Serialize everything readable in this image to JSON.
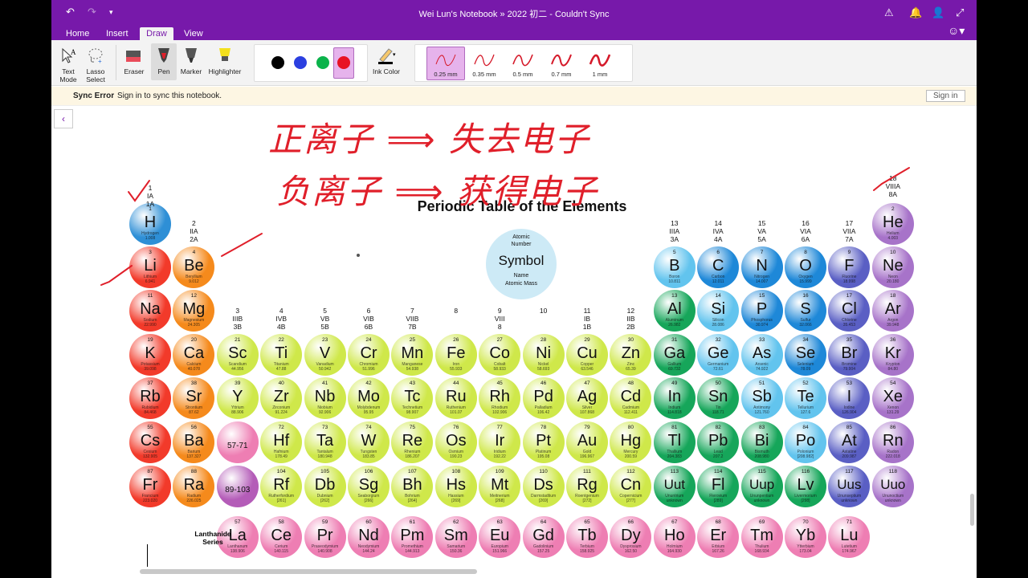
{
  "app": {
    "title": "Wei Lun's Notebook  »  2022 初二 - Couldn't Sync"
  },
  "tabs": [
    "Home",
    "Insert",
    "Draw",
    "View"
  ],
  "active_tab": "Draw",
  "ribbon": {
    "tools": [
      {
        "label": "Text Mode"
      },
      {
        "label": "Lasso Select"
      },
      {
        "label": "Eraser"
      },
      {
        "label": "Pen"
      },
      {
        "label": "Marker"
      },
      {
        "label": "Highlighter"
      }
    ],
    "colors": [
      "#000000",
      "#2b3fe0",
      "#0bb34b",
      "#e81224"
    ],
    "ink_color_label": "Ink Color",
    "pen_sizes": [
      "0.25 mm",
      "0.35 mm",
      "0.5 mm",
      "0.7 mm",
      "1 mm"
    ]
  },
  "sync": {
    "title": "Sync Error",
    "message": "Sign in to sync this notebook.",
    "button": "Sign in"
  },
  "handwriting": {
    "line1": "正离子 ⟹ 失去电子",
    "line2": "负离子 ⟹ 获得电子"
  },
  "table": {
    "title": "Periodic Table of the Elements",
    "legend": {
      "number": "Atomic Number",
      "symbol": "Symbol",
      "name": "Name",
      "mass": "Atomic  Mass"
    },
    "groups": [
      [
        "1",
        "IA",
        "1A"
      ],
      [
        "2",
        "IIA",
        "2A"
      ],
      [
        "3",
        "IIIB",
        "3B"
      ],
      [
        "4",
        "IVB",
        "4B"
      ],
      [
        "5",
        "VB",
        "5B"
      ],
      [
        "6",
        "VIB",
        "6B"
      ],
      [
        "7",
        "VIIB",
        "7B"
      ],
      [
        "8",
        "",
        ""
      ],
      [
        "9",
        "VIII",
        "8"
      ],
      [
        "10",
        "",
        ""
      ],
      [
        "11",
        "IB",
        "1B"
      ],
      [
        "12",
        "IIB",
        "2B"
      ],
      [
        "13",
        "IIIA",
        "3A"
      ],
      [
        "14",
        "IVA",
        "4A"
      ],
      [
        "15",
        "VA",
        "5A"
      ],
      [
        "16",
        "VIA",
        "6A"
      ],
      [
        "17",
        "VIIA",
        "7A"
      ],
      [
        "18",
        "VIIIA",
        "8A"
      ]
    ],
    "lanthanide_label": "Lanthanide Series",
    "elements": [
      [
        "1",
        "H",
        "Hydrogen",
        "1.008",
        1,
        1,
        "s1"
      ],
      [
        "2",
        "He",
        "Helium",
        "4.003",
        18,
        1,
        "ng"
      ],
      [
        "3",
        "Li",
        "Lithium",
        "6.941",
        1,
        2,
        "am"
      ],
      [
        "4",
        "Be",
        "Beryllium",
        "9.012",
        2,
        2,
        "ae"
      ],
      [
        "5",
        "B",
        "Boron",
        "10.811",
        13,
        2,
        "mlt"
      ],
      [
        "6",
        "C",
        "Carbon",
        "12.011",
        14,
        2,
        "nm"
      ],
      [
        "7",
        "N",
        "Nitrogen",
        "14.007",
        15,
        2,
        "nm"
      ],
      [
        "8",
        "O",
        "Oxygen",
        "15.999",
        16,
        2,
        "nm"
      ],
      [
        "9",
        "F",
        "Fluorine",
        "18.998",
        17,
        2,
        "hal"
      ],
      [
        "10",
        "Ne",
        "Neon",
        "20.180",
        18,
        2,
        "ng"
      ],
      [
        "11",
        "Na",
        "Sodium",
        "22.990",
        1,
        3,
        "am"
      ],
      [
        "12",
        "Mg",
        "Magnesium",
        "24.305",
        2,
        3,
        "ae"
      ],
      [
        "13",
        "Al",
        "Aluminum",
        "26.982",
        13,
        3,
        "pt"
      ],
      [
        "14",
        "Si",
        "Silicon",
        "28.086",
        14,
        3,
        "mlt"
      ],
      [
        "15",
        "P",
        "Phosphorus",
        "30.974",
        15,
        3,
        "nm"
      ],
      [
        "16",
        "S",
        "Sulfur",
        "32.066",
        16,
        3,
        "nm"
      ],
      [
        "17",
        "Cl",
        "Chlorine",
        "35.453",
        17,
        3,
        "hal"
      ],
      [
        "18",
        "Ar",
        "Argon",
        "39.948",
        18,
        3,
        "ng"
      ],
      [
        "19",
        "K",
        "Potassium",
        "39.098",
        1,
        4,
        "am"
      ],
      [
        "20",
        "Ca",
        "Calcium",
        "40.078",
        2,
        4,
        "ae"
      ],
      [
        "21",
        "Sc",
        "Scandium",
        "44.956",
        3,
        4,
        "tm"
      ],
      [
        "22",
        "Ti",
        "Titanium",
        "47.88",
        4,
        4,
        "tm"
      ],
      [
        "23",
        "V",
        "Vanadium",
        "50.942",
        5,
        4,
        "tm"
      ],
      [
        "24",
        "Cr",
        "Chromium",
        "51.996",
        6,
        4,
        "tm"
      ],
      [
        "25",
        "Mn",
        "Manganese",
        "54.938",
        7,
        4,
        "tm"
      ],
      [
        "26",
        "Fe",
        "Iron",
        "55.933",
        8,
        4,
        "tm"
      ],
      [
        "27",
        "Co",
        "Cobalt",
        "58.933",
        9,
        4,
        "tm"
      ],
      [
        "28",
        "Ni",
        "Nickel",
        "58.693",
        10,
        4,
        "tm"
      ],
      [
        "29",
        "Cu",
        "Copper",
        "63.546",
        11,
        4,
        "tm"
      ],
      [
        "30",
        "Zn",
        "Zinc",
        "65.39",
        12,
        4,
        "tm"
      ],
      [
        "31",
        "Ga",
        "Gallium",
        "69.732",
        13,
        4,
        "pt"
      ],
      [
        "32",
        "Ge",
        "Germanium",
        "72.61",
        14,
        4,
        "mlt"
      ],
      [
        "33",
        "As",
        "Arsenic",
        "74.922",
        15,
        4,
        "mlt"
      ],
      [
        "34",
        "Se",
        "Selenium",
        "78.09",
        16,
        4,
        "nm"
      ],
      [
        "35",
        "Br",
        "Bromine",
        "79.904",
        17,
        4,
        "hal"
      ],
      [
        "36",
        "Kr",
        "Krypton",
        "84.80",
        18,
        4,
        "ng"
      ],
      [
        "37",
        "Rb",
        "Rubidium",
        "84.468",
        1,
        5,
        "am"
      ],
      [
        "38",
        "Sr",
        "Strontium",
        "87.62",
        2,
        5,
        "ae"
      ],
      [
        "39",
        "Y",
        "Yttrium",
        "88.906",
        3,
        5,
        "tm"
      ],
      [
        "40",
        "Zr",
        "Zirconium",
        "91.224",
        4,
        5,
        "tm"
      ],
      [
        "41",
        "Nb",
        "Niobium",
        "92.906",
        5,
        5,
        "tm"
      ],
      [
        "42",
        "Mo",
        "Molybdenum",
        "95.95",
        6,
        5,
        "tm"
      ],
      [
        "43",
        "Tc",
        "Technetium",
        "98.907",
        7,
        5,
        "tm"
      ],
      [
        "44",
        "Ru",
        "Ruthenium",
        "101.07",
        8,
        5,
        "tm"
      ],
      [
        "45",
        "Rh",
        "Rhodium",
        "102.906",
        9,
        5,
        "tm"
      ],
      [
        "46",
        "Pd",
        "Palladium",
        "106.42",
        10,
        5,
        "tm"
      ],
      [
        "47",
        "Ag",
        "Silver",
        "107.868",
        11,
        5,
        "tm"
      ],
      [
        "48",
        "Cd",
        "Cadmium",
        "112.411",
        12,
        5,
        "tm"
      ],
      [
        "49",
        "In",
        "Indium",
        "114.818",
        13,
        5,
        "pt"
      ],
      [
        "50",
        "Sn",
        "Tin",
        "118.71",
        14,
        5,
        "pt"
      ],
      [
        "51",
        "Sb",
        "Antimony",
        "121.760",
        15,
        5,
        "mlt"
      ],
      [
        "52",
        "Te",
        "Tellurium",
        "127.6",
        16,
        5,
        "mlt"
      ],
      [
        "53",
        "I",
        "Iodine",
        "126.904",
        17,
        5,
        "hal"
      ],
      [
        "54",
        "Xe",
        "Xenon",
        "131.29",
        18,
        5,
        "ng"
      ],
      [
        "55",
        "Cs",
        "Cesium",
        "132.905",
        1,
        6,
        "am"
      ],
      [
        "56",
        "Ba",
        "Barium",
        "137.327",
        2,
        6,
        "ae"
      ],
      [
        "",
        "57-71",
        "",
        "",
        3,
        6,
        "lnb"
      ],
      [
        "72",
        "Hf",
        "Hafnium",
        "178.49",
        4,
        6,
        "tm"
      ],
      [
        "73",
        "Ta",
        "Tantalum",
        "180.948",
        5,
        6,
        "tm"
      ],
      [
        "74",
        "W",
        "Tungsten",
        "183.85",
        6,
        6,
        "tm"
      ],
      [
        "75",
        "Re",
        "Rhenium",
        "186.207",
        7,
        6,
        "tm"
      ],
      [
        "76",
        "Os",
        "Osmium",
        "190.23",
        8,
        6,
        "tm"
      ],
      [
        "77",
        "Ir",
        "Iridium",
        "192.22",
        9,
        6,
        "tm"
      ],
      [
        "78",
        "Pt",
        "Platinum",
        "195.08",
        10,
        6,
        "tm"
      ],
      [
        "79",
        "Au",
        "Gold",
        "196.967",
        11,
        6,
        "tm"
      ],
      [
        "80",
        "Hg",
        "Mercury",
        "200.59",
        12,
        6,
        "tm"
      ],
      [
        "81",
        "Tl",
        "Thallium",
        "204.383",
        13,
        6,
        "pt"
      ],
      [
        "82",
        "Pb",
        "Lead",
        "207.2",
        14,
        6,
        "pt"
      ],
      [
        "83",
        "Bi",
        "Bismuth",
        "208.980",
        15,
        6,
        "pt"
      ],
      [
        "84",
        "Po",
        "Polonium",
        "[208.982]",
        16,
        6,
        "mlt"
      ],
      [
        "85",
        "At",
        "Astatine",
        "209.987",
        17,
        6,
        "hal"
      ],
      [
        "86",
        "Rn",
        "Radon",
        "222.018",
        18,
        6,
        "ng"
      ],
      [
        "87",
        "Fr",
        "Francium",
        "223.020",
        1,
        7,
        "am"
      ],
      [
        "88",
        "Ra",
        "Radium",
        "226.025",
        2,
        7,
        "ae"
      ],
      [
        "",
        "89-103",
        "",
        "",
        3,
        7,
        "acb"
      ],
      [
        "104",
        "Rf",
        "Rutherfordium",
        "[261]",
        4,
        7,
        "tm"
      ],
      [
        "105",
        "Db",
        "Dubnium",
        "[262]",
        5,
        7,
        "tm"
      ],
      [
        "106",
        "Sg",
        "Seaborgium",
        "[266]",
        6,
        7,
        "tm"
      ],
      [
        "107",
        "Bh",
        "Bohrium",
        "[264]",
        7,
        7,
        "tm"
      ],
      [
        "108",
        "Hs",
        "Hassium",
        "[269]",
        8,
        7,
        "tm"
      ],
      [
        "109",
        "Mt",
        "Meitnerium",
        "[268]",
        9,
        7,
        "tm"
      ],
      [
        "110",
        "Ds",
        "Darmstadtium",
        "[269]",
        10,
        7,
        "tm"
      ],
      [
        "111",
        "Rg",
        "Roentgenium",
        "[272]",
        11,
        7,
        "tm"
      ],
      [
        "112",
        "Cn",
        "Copernicium",
        "[277]",
        12,
        7,
        "tm"
      ],
      [
        "113",
        "Uut",
        "Ununtrium",
        "unknown",
        13,
        7,
        "pt"
      ],
      [
        "114",
        "Fl",
        "Flerovium",
        "[289]",
        14,
        7,
        "pt"
      ],
      [
        "115",
        "Uup",
        "Ununpentium",
        "unknown",
        15,
        7,
        "pt"
      ],
      [
        "116",
        "Lv",
        "Livermorium",
        "[298]",
        16,
        7,
        "pt"
      ],
      [
        "117",
        "Uus",
        "Ununseptium",
        "unknown",
        17,
        7,
        "hal"
      ],
      [
        "118",
        "Uuo",
        "Ununoctium",
        "unknown",
        18,
        7,
        "ng"
      ],
      [
        "57",
        "La",
        "Lanthanum",
        "138.906",
        3,
        8,
        "ln"
      ],
      [
        "58",
        "Ce",
        "Cerium",
        "140.115",
        4,
        8,
        "ln"
      ],
      [
        "59",
        "Pr",
        "Praseodymium",
        "140.908",
        5,
        8,
        "ln"
      ],
      [
        "60",
        "Nd",
        "Neodymium",
        "144.24",
        6,
        8,
        "ln"
      ],
      [
        "61",
        "Pm",
        "Promethium",
        "144.913",
        7,
        8,
        "ln"
      ],
      [
        "62",
        "Sm",
        "Samarium",
        "150.36",
        8,
        8,
        "ln"
      ],
      [
        "63",
        "Eu",
        "Europium",
        "151.966",
        9,
        8,
        "ln"
      ],
      [
        "64",
        "Gd",
        "Gadolinium",
        "157.25",
        10,
        8,
        "ln"
      ],
      [
        "65",
        "Tb",
        "Terbium",
        "158.925",
        11,
        8,
        "ln"
      ],
      [
        "66",
        "Dy",
        "Dysprosium",
        "162.50",
        12,
        8,
        "ln"
      ],
      [
        "67",
        "Ho",
        "Holmium",
        "164.930",
        13,
        8,
        "ln"
      ],
      [
        "68",
        "Er",
        "Erbium",
        "167.26",
        14,
        8,
        "ln"
      ],
      [
        "69",
        "Tm",
        "Thulium",
        "168.934",
        15,
        8,
        "ln"
      ],
      [
        "70",
        "Yb",
        "Ytterbium",
        "173.04",
        16,
        8,
        "ln"
      ],
      [
        "71",
        "Lu",
        "Lutetium",
        "174.967",
        17,
        8,
        "ln"
      ]
    ]
  },
  "category_colors": {
    "s1": "#2e8fd6",
    "am": "#f23a2a",
    "ae": "#f58a1c",
    "tm": "#cfe84a",
    "pt": "#16a65a",
    "mlt": "#62c4ee",
    "nm": "#1e88d8",
    "hal": "#5a5fc4",
    "ng": "#a773c9",
    "ln": "#ee7eb3",
    "lnb": "#ee7eb3",
    "acb": "#b45cb8"
  },
  "ink_color": "#e01f2a"
}
